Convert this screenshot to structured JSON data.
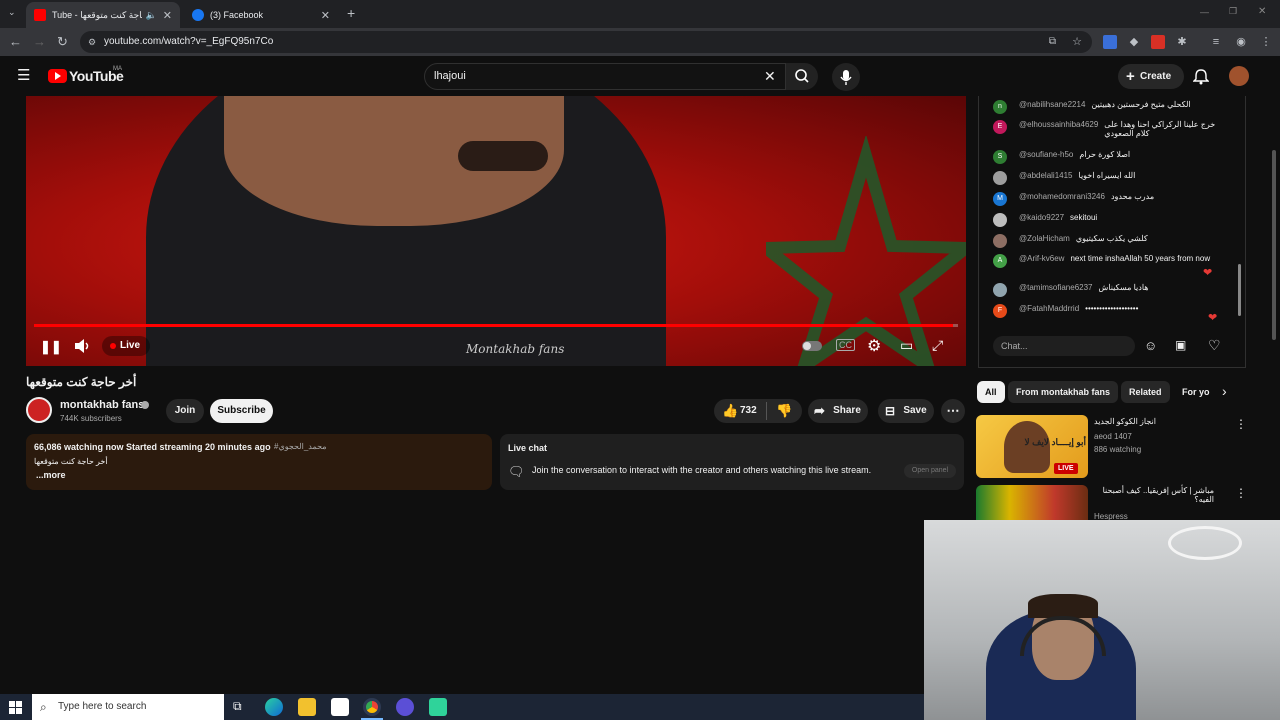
{
  "browser": {
    "tabs": [
      {
        "title": "Tube - أخر حاجة كنت متوقعها",
        "active": true
      },
      {
        "title": "(3) Facebook",
        "active": false
      }
    ],
    "url": "youtube.com/watch?v=_EgFQ95n7Co"
  },
  "youtube": {
    "logo_text": "YouTube",
    "region": "MA",
    "search_value": "lhajoui",
    "create_label": "Create"
  },
  "player": {
    "live_label": "Live",
    "watermark": "Montakhab fans",
    "progress_fraction": 0.995
  },
  "video": {
    "title": "أخر حاجة كنت متوقعها",
    "channel_name": "montakhab fans",
    "subscribers": "744K subscribers",
    "join_label": "Join",
    "subscribe_label": "Subscribe",
    "likes": "732",
    "share_label": "Share",
    "save_label": "Save",
    "description": {
      "stats": "66,086 watching now  Started streaming 20 minutes ago",
      "hashtag": "#محمد_الحجوي",
      "line": "أخر حاجة كنت متوقعها",
      "more": "...more"
    }
  },
  "live_chat_note": {
    "heading": "Live chat",
    "text": "Join the conversation to interact with the creator and others watching this live stream.",
    "open_panel": "Open panel"
  },
  "chat": {
    "messages": [
      {
        "author": "@nabilihsane2214",
        "text": "الكحلي متيح فرحستين دهبيتين",
        "avatar_letter": "n",
        "avatar_color": "#2e7d32"
      },
      {
        "author": "@elhoussainhiba4629",
        "text": "خرج علينا الركراكي احنا وهدا على كلام الصعودي",
        "avatar_letter": "E",
        "avatar_color": "#c2185b"
      },
      {
        "author": "@soufiane-h5o",
        "text": "اصلا كورة حرام",
        "avatar_letter": "S",
        "avatar_color": "#2e7d32"
      },
      {
        "author": "@abdelali1415",
        "text": "الله ايسيراه اخويا",
        "avatar_letter": "",
        "avatar_color": "#9e9e9e"
      },
      {
        "author": "@mohamedomrani3246",
        "text": "مدرب محدود",
        "avatar_letter": "M",
        "avatar_color": "#1976d2"
      },
      {
        "author": "@kaido9227",
        "text": "sekitoui",
        "avatar_letter": "",
        "avatar_color": "#bdbdbd"
      },
      {
        "author": "@ZolaHicham",
        "text": "كلشي يكذب سكيتيوي",
        "avatar_letter": "",
        "avatar_color": "#8d6e63"
      },
      {
        "author": "@Arif-kv6ew",
        "text": "next time inshaAllah 50 years from now",
        "avatar_letter": "A",
        "avatar_color": "#43a047"
      },
      {
        "author": "@tamimsofiane6237",
        "text": "هاديا مسكيناش",
        "avatar_letter": "",
        "avatar_color": "#90a4ae"
      },
      {
        "author": "@FatahMaddrrid",
        "text": "•••••••••••••••••••",
        "avatar_letter": "F",
        "avatar_color": "#e64a19"
      }
    ],
    "input_placeholder": "Chat..."
  },
  "chips": [
    {
      "label": "All",
      "selected": true
    },
    {
      "label": "From montakhab fans",
      "selected": false
    },
    {
      "label": "Related",
      "selected": false
    },
    {
      "label": "For yo",
      "selected": false
    }
  ],
  "recommendations": [
    {
      "title": "انجاز الكوكو الجديد",
      "channel": "aeod 1407",
      "meta": "886 watching",
      "thumb_text": "أبو إيــــاد لايف لا",
      "badge": "LIVE"
    },
    {
      "title": "مباشر | كأس إفريقيا.. كيف أصبحنا الفيه؟",
      "channel": "Hespress",
      "meta": ""
    }
  ],
  "taskbar": {
    "search_placeholder": "Type here to search"
  },
  "colors": {
    "accent_red": "#ff0000",
    "subscribe_bg": "#f1f1f1",
    "desc_bg": "#2b1a0d"
  }
}
